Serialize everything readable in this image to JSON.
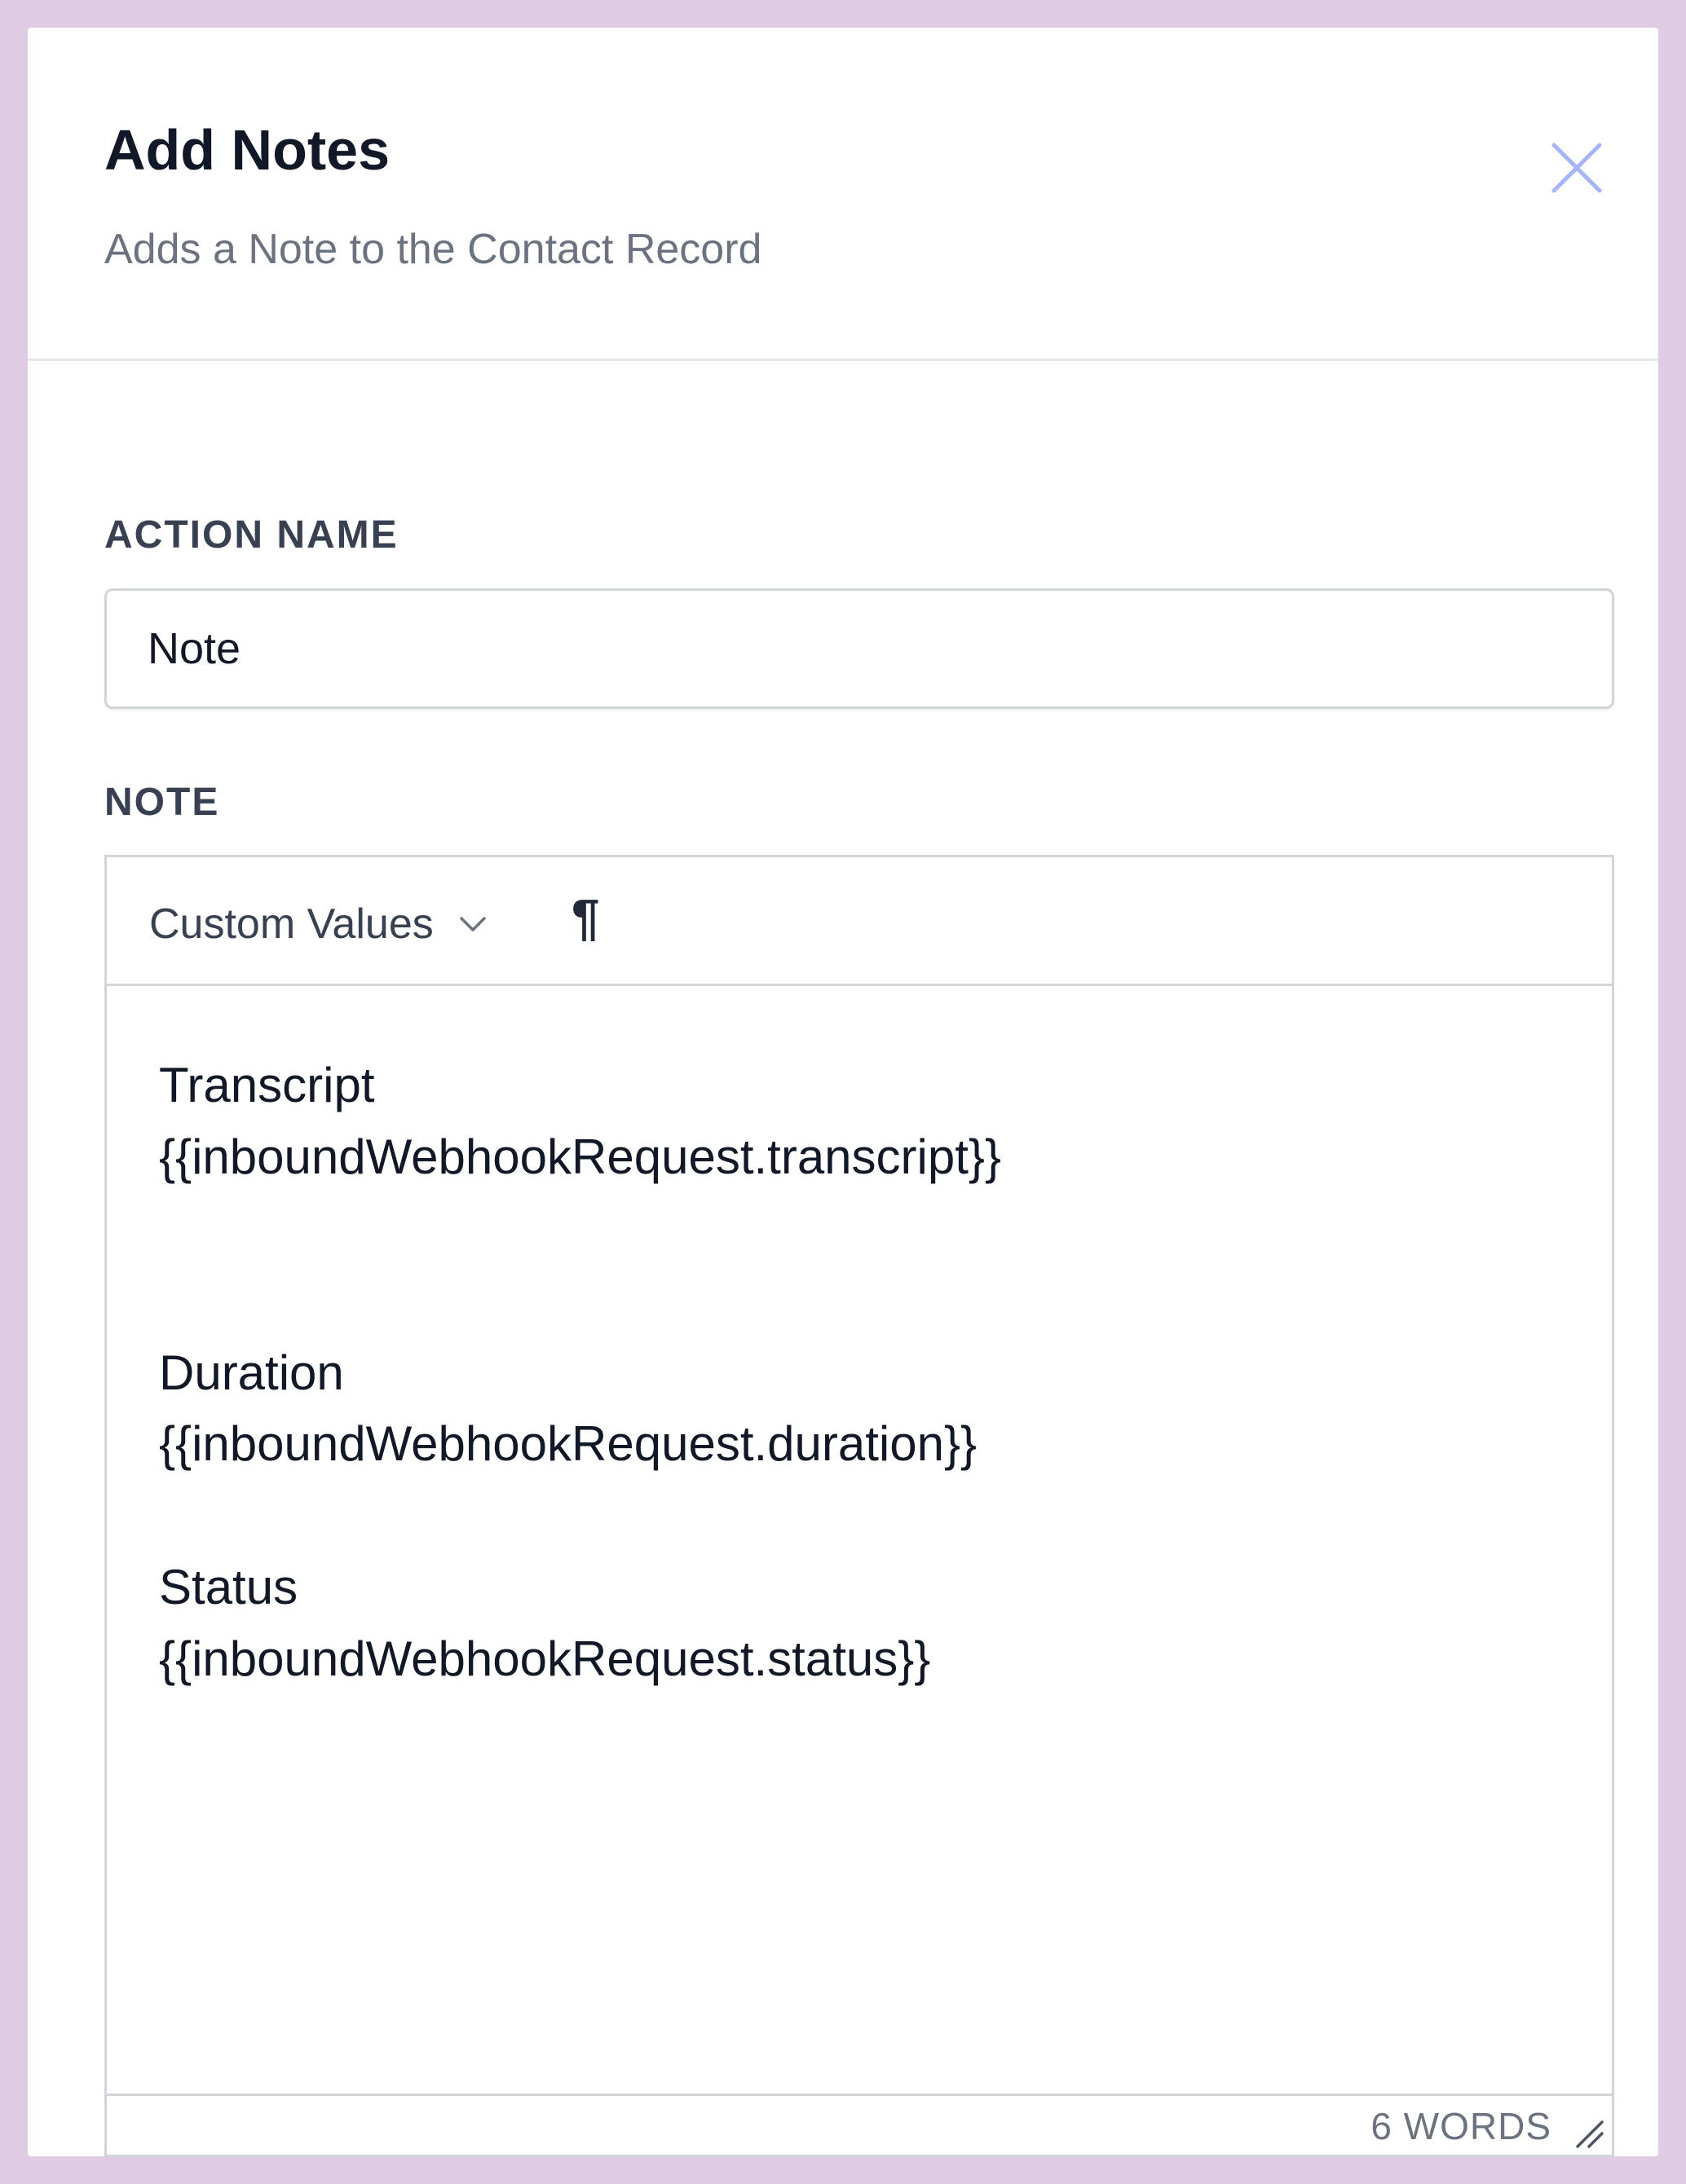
{
  "dialog": {
    "title": "Add Notes",
    "subtitle": "Adds a Note to the Contact Record",
    "close_icon": "close-icon"
  },
  "action_name": {
    "label": "ACTION NAME",
    "value": "Note"
  },
  "note": {
    "label": "NOTE",
    "toolbar": {
      "custom_values_label": "Custom Values",
      "chevron_icon": "chevron-down-icon",
      "paragraph_symbol": "¶"
    },
    "content": {
      "line1": "Transcript",
      "line2": "{{inboundWebhookRequest.transcript}}",
      "line3": "Duration",
      "line4": "{{inboundWebhookRequest.duration}}",
      "line5": "Status",
      "line6": "{{inboundWebhookRequest.status}}"
    },
    "word_count": "6 WORDS",
    "resize_icon": "resize-handle-icon"
  },
  "colors": {
    "background": "#dfcbe4",
    "panel": "#ffffff",
    "close_icon": "#a5b4fc",
    "title_text": "#111827",
    "muted_text": "#6b7280"
  }
}
